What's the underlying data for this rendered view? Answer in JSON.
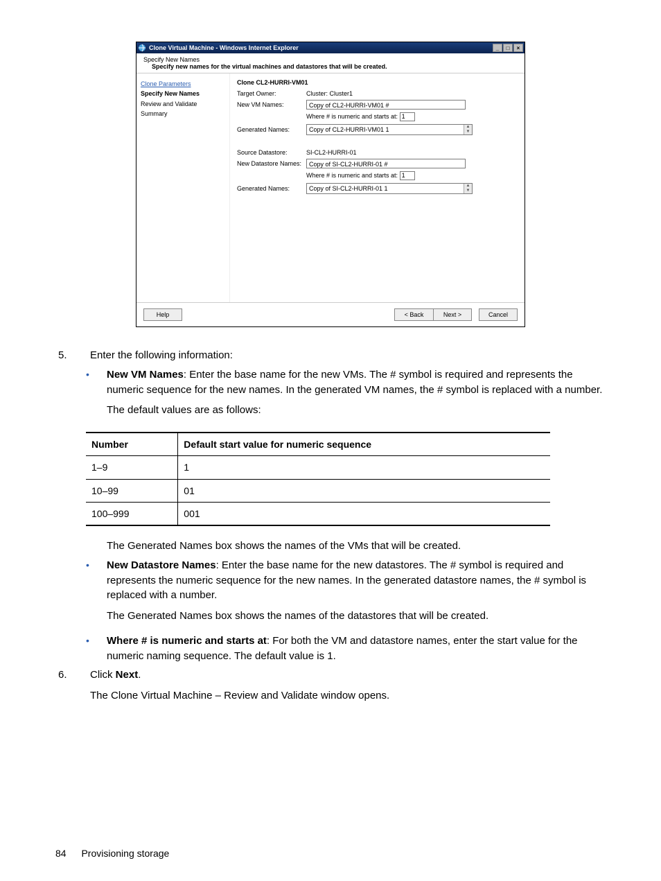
{
  "window": {
    "title": "Clone Virtual Machine - Windows Internet Explorer",
    "header_title": "Specify New Names",
    "header_sub": "Specify new names for the virtual machines and datastores that will be created.",
    "nav": {
      "clone_params": "Clone Parameters",
      "specify_names": "Specify New Names",
      "review": "Review and Validate",
      "summary": "Summary"
    },
    "main": {
      "clone_title": "Clone CL2-HURRI-VM01",
      "target_owner_label": "Target Owner:",
      "target_owner_value": "Cluster: Cluster1",
      "new_vm_names_label": "New VM Names:",
      "new_vm_names_value": "Copy of CL2-HURRI-VM01 #",
      "numeric_label": "Where # is numeric and starts at:",
      "vm_start_value": "1",
      "gen_names_label": "Generated Names:",
      "vm_gen_value": "Copy of CL2-HURRI-VM01 1",
      "source_ds_label": "Source Datastore:",
      "source_ds_value": "SI-CL2-HURRI-01",
      "new_ds_label": "New Datastore Names:",
      "new_ds_value": "Copy of SI-CL2-HURRI-01 #",
      "ds_start_value": "1",
      "ds_gen_value": "Copy of SI-CL2-HURRI-01 1"
    },
    "buttons": {
      "help": "Help",
      "back": "< Back",
      "next": "Next >",
      "cancel": "Cancel"
    }
  },
  "doc": {
    "step5_num": "5.",
    "step5_text": "Enter the following information:",
    "new_vm_bold": "New VM Names",
    "new_vm_text": ": Enter the base name for the new VMs. The # symbol is required and represents the numeric sequence for the new names. In the generated VM names, the # symbol is replaced with a number.",
    "default_intro": "The default values are as follows:",
    "table": {
      "header_number": "Number",
      "header_default": "Default start value for numeric sequence",
      "rows": [
        {
          "number": "1–9",
          "default": "1"
        },
        {
          "number": "10–99",
          "default": "01"
        },
        {
          "number": "100–999",
          "default": "001"
        }
      ]
    },
    "gen_vm_text": "The Generated Names box shows the names of the VMs that will be created.",
    "new_ds_bold": "New Datastore Names",
    "new_ds_text": ": Enter the base name for the new datastores. The # symbol is required and represents the numeric sequence for the new names. In the generated datastore names, the # symbol is replaced with a number.",
    "gen_ds_text": "The Generated Names box shows the names of the datastores that will be created.",
    "where_bold": "Where # is numeric and starts at",
    "where_text": ": For both the VM and datastore names, enter the start value for the numeric naming sequence. The default value is 1.",
    "step6_num": "6.",
    "step6_pre": "Click ",
    "step6_bold": "Next",
    "step6_post": ".",
    "step6_result": "The Clone Virtual Machine – Review and Validate window opens."
  },
  "footer": {
    "page_no": "84",
    "section": "Provisioning storage"
  }
}
